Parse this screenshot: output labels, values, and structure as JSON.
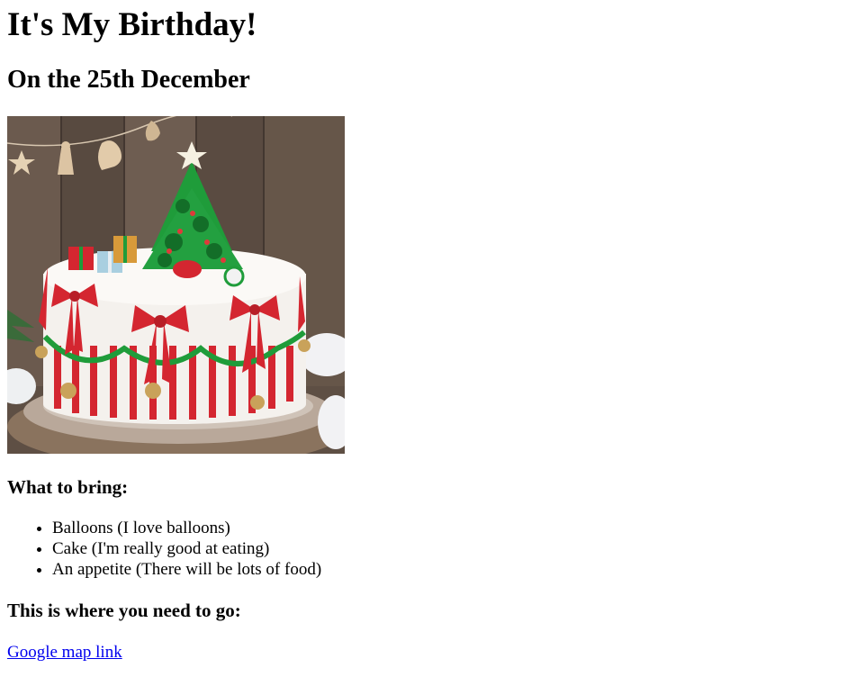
{
  "page": {
    "title": "It's My Birthday!",
    "subtitle": "On the 25th December"
  },
  "image": {
    "icon": "christmas-cake-photo",
    "colors": {
      "wood": "#6b5a4e",
      "icing": "#f4f1ed",
      "ribbon": "#d42630",
      "tree": "#1f9c3a",
      "gold": "#c9a25a"
    }
  },
  "bring": {
    "heading": "What to bring:",
    "items": [
      "Balloons (I love balloons)",
      "Cake (I'm really good at eating)",
      "An appetite (There will be lots of food)"
    ]
  },
  "location": {
    "heading": "This is where you need to go:",
    "link_text": "Google map link"
  }
}
